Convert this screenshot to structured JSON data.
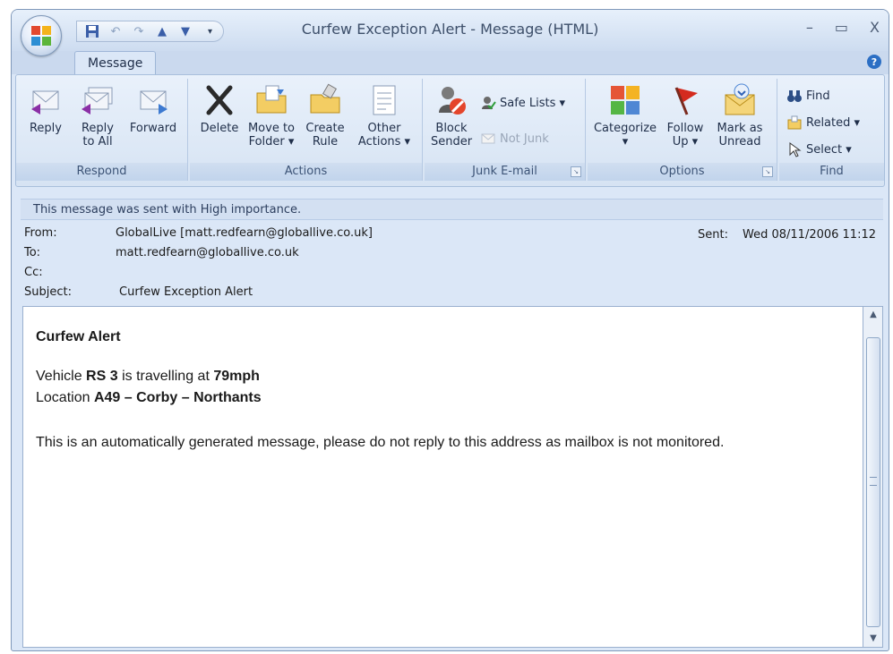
{
  "window": {
    "title": "Curfew Exception Alert - Message (HTML)",
    "minimize": "–",
    "maximize": "▭",
    "close": "X"
  },
  "tabs": [
    {
      "label": "Message"
    }
  ],
  "ribbon": {
    "groups": {
      "respond": {
        "label": "Respond",
        "reply": "Reply",
        "reply_all_1": "Reply",
        "reply_all_2": "to All",
        "forward": "Forward"
      },
      "actions": {
        "label": "Actions",
        "delete": "Delete",
        "move_1": "Move to",
        "move_2": "Folder ▾",
        "create_1": "Create",
        "create_2": "Rule",
        "other_1": "Other",
        "other_2": "Actions ▾"
      },
      "junk": {
        "label": "Junk E-mail",
        "block_1": "Block",
        "block_2": "Sender",
        "safe_lists": "Safe Lists ▾",
        "not_junk": "Not Junk"
      },
      "options": {
        "label": "Options",
        "categorize_1": "Categorize",
        "categorize_2": "▾",
        "follow_1": "Follow",
        "follow_2": "Up ▾",
        "mark_1": "Mark as",
        "mark_2": "Unread"
      },
      "find": {
        "label": "Find",
        "find": "Find",
        "related": "Related ▾",
        "select": "Select ▾"
      }
    }
  },
  "infobar": "This message was sent with High importance.",
  "header": {
    "from_label": "From:",
    "from": "GlobalLive [matt.redfearn@globallive.co.uk]",
    "to_label": "To:",
    "to": "matt.redfearn@globallive.co.uk",
    "cc_label": "Cc:",
    "subject_label": "Subject:",
    "subject": "Curfew Exception Alert",
    "sent_label": "Sent:",
    "sent": "Wed 08/11/2006 11:12"
  },
  "body": {
    "heading": "Curfew Alert",
    "line1_a": "Vehicle ",
    "vehicle": "RS 3",
    "line1_b": " is travelling at ",
    "speed": "79mph",
    "line2_a": "Location ",
    "location": "A49 – Corby – Northants",
    "footer": "This is an automatically generated message, please do not reply to this address as mailbox is not monitored."
  }
}
